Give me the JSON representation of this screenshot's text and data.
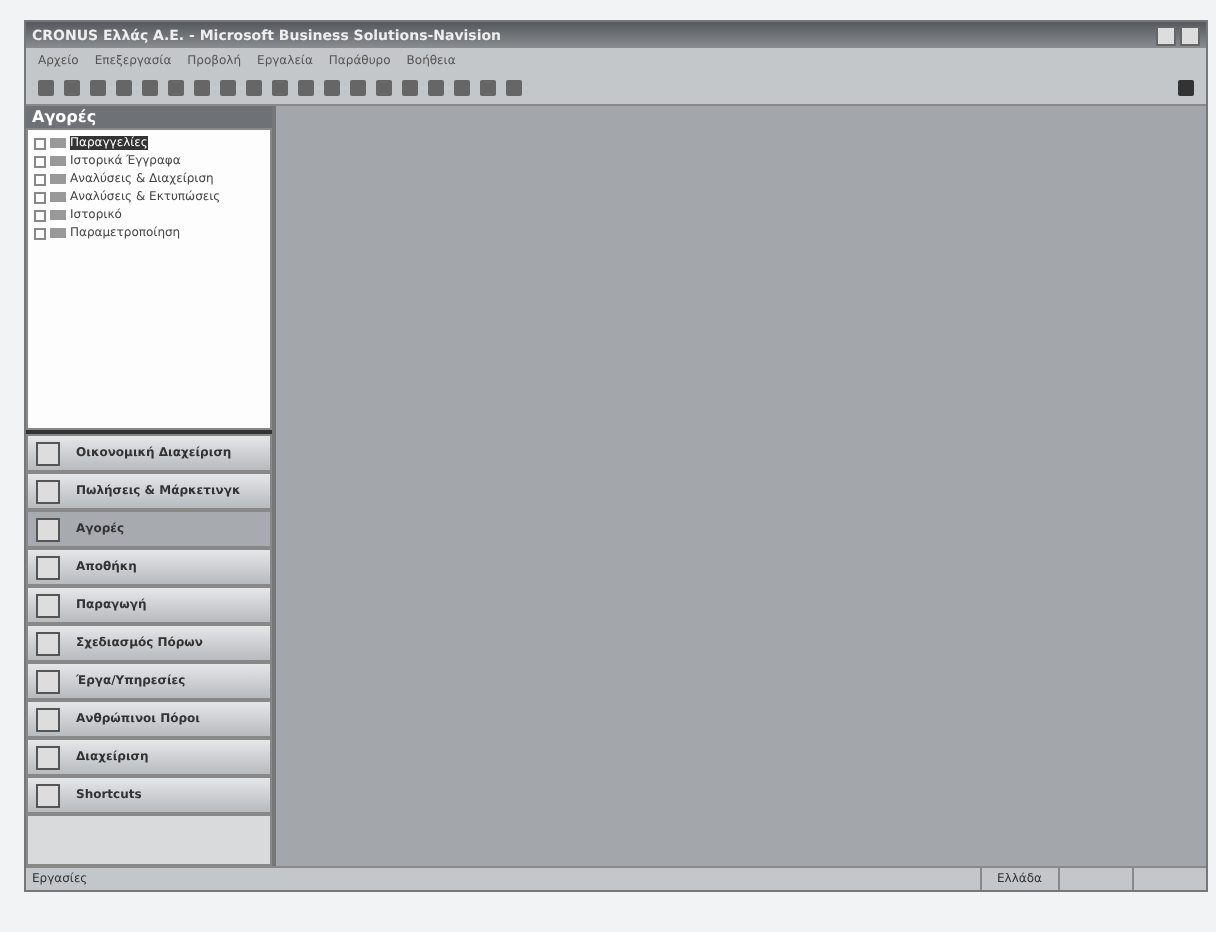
{
  "window": {
    "title": "CRONUS Ελλάς Α.Ε. - Microsoft Business Solutions-Navision"
  },
  "menu": [
    "Αρχείο",
    "Επεξεργασία",
    "Προβολή",
    "Εργαλεία",
    "Παράθυρο",
    "Βοήθεια"
  ],
  "navigation_pane": {
    "title": "Αγορές",
    "tree": [
      {
        "label": "Παραγγελίες",
        "selected": true
      },
      {
        "label": "Ιστορικά Έγγραφα",
        "selected": false
      },
      {
        "label": "Αναλύσεις & Διαχείριση",
        "selected": false
      },
      {
        "label": "Αναλύσεις & Εκτυπώσεις",
        "selected": false
      },
      {
        "label": "Ιστορικό",
        "selected": false
      },
      {
        "label": "Παραμετροποίηση",
        "selected": false
      }
    ],
    "buttons": [
      {
        "label": "Οικονομική Διαχείριση",
        "selected": false
      },
      {
        "label": "Πωλήσεις & Μάρκετινγκ",
        "selected": false
      },
      {
        "label": "Αγορές",
        "selected": true
      },
      {
        "label": "Αποθήκη",
        "selected": false
      },
      {
        "label": "Παραγωγή",
        "selected": false
      },
      {
        "label": "Σχεδιασμός Πόρων",
        "selected": false
      },
      {
        "label": "Έργα/Υπηρεσίες",
        "selected": false
      },
      {
        "label": "Ανθρώπινοι Πόροι",
        "selected": false
      },
      {
        "label": "Διαχείριση",
        "selected": false
      },
      {
        "label": "Shortcuts",
        "selected": false
      }
    ]
  },
  "status_bar": {
    "left": "Εργασίες",
    "right": "Ελλάδα"
  }
}
